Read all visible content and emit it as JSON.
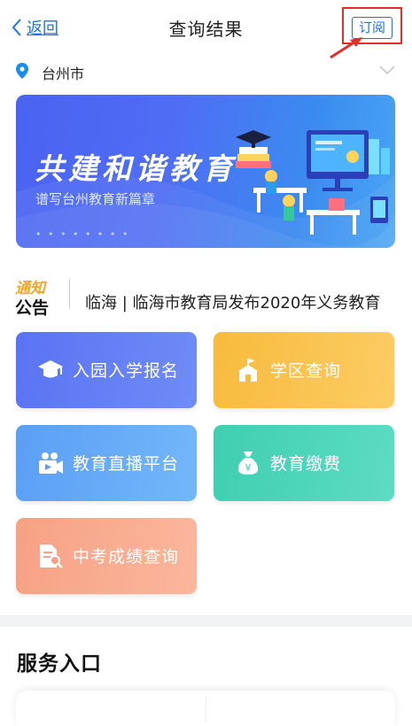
{
  "nav": {
    "back_label": "返回",
    "title": "查询结果",
    "subscribe_label": "订阅"
  },
  "location": {
    "city": "台州市"
  },
  "banner": {
    "title": "共建和谐教育",
    "subtitle": "谱写台州教育新篇章",
    "dots": "• • • • • • • •"
  },
  "notice": {
    "logo_line1": "通知",
    "logo_line2": "公告",
    "text": "临海 | 临海市教育局发布2020年义务教育"
  },
  "tiles": [
    {
      "label": "入园入学报名",
      "icon": "graduation-cap-icon",
      "color": "#5a73f3"
    },
    {
      "label": "学区查询",
      "icon": "school-building-icon",
      "color": "#f7bb3d"
    },
    {
      "label": "教育直播平台",
      "icon": "live-camera-icon",
      "color": "#5a9ff5"
    },
    {
      "label": "教育缴费",
      "icon": "money-bag-icon",
      "color": "#3fcfb0"
    },
    {
      "label": "中考成绩查询",
      "icon": "document-search-icon",
      "color": "#f6a184"
    }
  ],
  "services": {
    "title": "服务入口"
  }
}
